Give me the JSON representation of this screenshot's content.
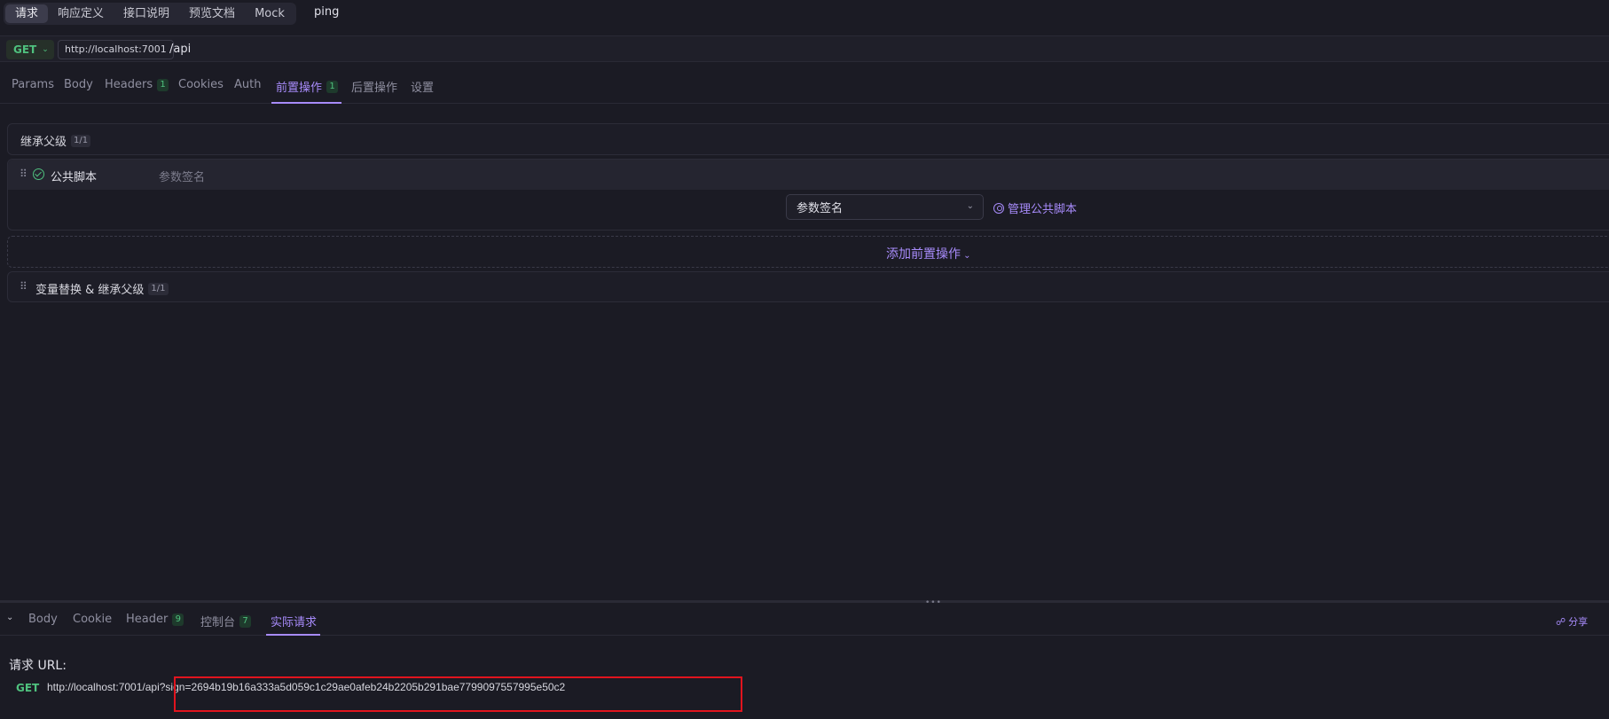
{
  "top_tabs": [
    {
      "label": "请求",
      "active": true
    },
    {
      "label": "响应定义",
      "active": false
    },
    {
      "label": "接口说明",
      "active": false
    },
    {
      "label": "预览文档",
      "active": false
    },
    {
      "label": "Mock",
      "active": false
    }
  ],
  "api_name": "ping",
  "url_bar": {
    "method": "GET",
    "host": "http://localhost:7001",
    "path": "/api"
  },
  "request_tabs": [
    {
      "label": "Params"
    },
    {
      "label": "Body"
    },
    {
      "label": "Headers",
      "badge": "1"
    },
    {
      "label": "Cookies"
    },
    {
      "label": "Auth"
    },
    {
      "label": "前置操作",
      "badge": "1",
      "active": true
    },
    {
      "label": "后置操作"
    },
    {
      "label": "设置"
    }
  ],
  "inherit_parent": {
    "label": "继承父级",
    "count": "1/1"
  },
  "script_block": {
    "title": "公共脚本",
    "subtitle": "参数签名",
    "selected_script": "参数签名",
    "manage_label": "管理公共脚本"
  },
  "add_pre_action": "添加前置操作",
  "variable_replace": {
    "label": "变量替换 & 继承父级",
    "count": "1/1"
  },
  "response_tabs": [
    {
      "label": "Body"
    },
    {
      "label": "Cookie"
    },
    {
      "label": "Header",
      "badge": "9"
    },
    {
      "label": "控制台",
      "badge": "7"
    },
    {
      "label": "实际请求",
      "active": true
    }
  ],
  "share_label": "分享",
  "actual_request": {
    "label": "请求 URL:",
    "method": "GET",
    "url": "http://localhost:7001/api?sign=2694b19b16a333a5d059c1c29ae0afeb24b2205b291bae7799097557995e50c2"
  },
  "colors": {
    "accent": "#a78bfa",
    "method_get": "#4fc17e",
    "highlight": "#e1141e",
    "background": "#1b1b24"
  }
}
